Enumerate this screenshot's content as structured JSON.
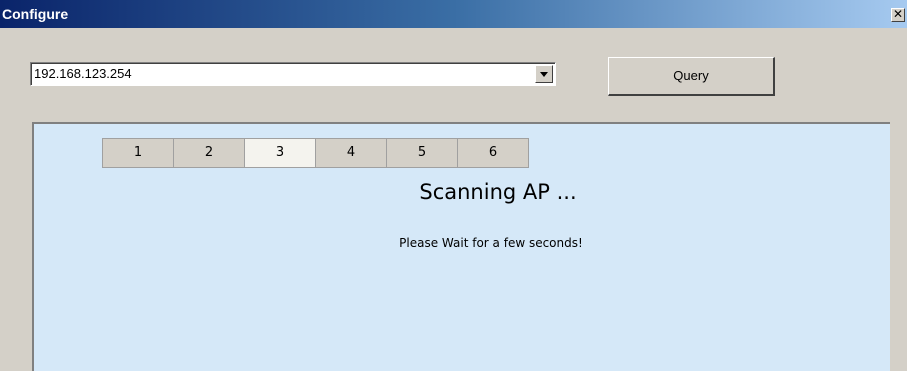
{
  "window": {
    "title": "Configure",
    "close_glyph": "✕"
  },
  "address": {
    "value": "192.168.123.254"
  },
  "query_button": {
    "label": "Query"
  },
  "steps": {
    "items": [
      "1",
      "2",
      "3",
      "4",
      "5",
      "6"
    ],
    "active": "3"
  },
  "status": {
    "heading": "Scanning AP ...",
    "message": "Please Wait for a few seconds!"
  },
  "colors": {
    "panel_background": "#d5e8f8",
    "titlebar_start": "#0a246a",
    "titlebar_end": "#a6caf0",
    "active_step": "#f4f3ee"
  }
}
